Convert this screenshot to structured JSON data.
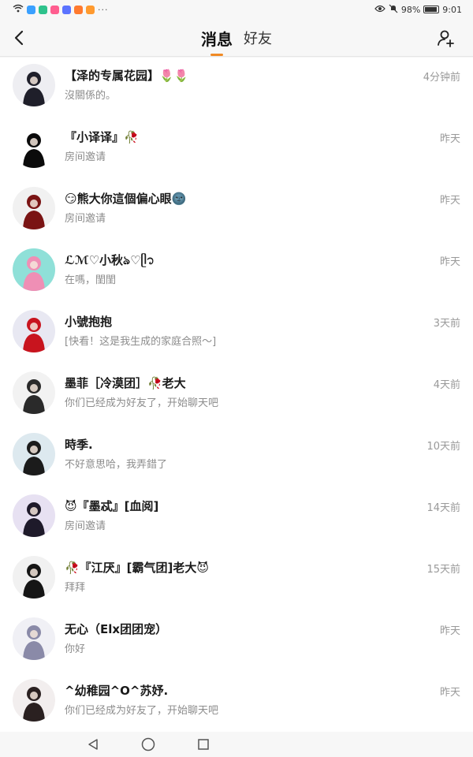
{
  "status_bar": {
    "battery": "98%",
    "time": "9:01",
    "more": "···",
    "app_colors": [
      "#3aa0ff",
      "#2ec28c",
      "#ff5d8f",
      "#5b73ff",
      "#ff7a2f",
      "#ff9a2f"
    ]
  },
  "header": {
    "tabs": [
      {
        "label": "消息",
        "active": true
      },
      {
        "label": "好友",
        "active": false
      }
    ],
    "accent_color": "#f08a24"
  },
  "messages": [
    {
      "name": "【泽的专属花园】🌷🌷",
      "preview": "沒關係的。",
      "time": "4分钟前",
      "avatar_bg": "#eeeef2",
      "avatar_fg": "#1f1f2a"
    },
    {
      "name": "『小译译』🥀",
      "preview": "房间邀请",
      "time": "昨天",
      "avatar_bg": "#ffffff",
      "avatar_fg": "#0b0b0b"
    },
    {
      "name": "😏熊大你這個偏心眼🌚",
      "preview": "房间邀请",
      "time": "昨天",
      "avatar_bg": "#f1f1f1",
      "avatar_fg": "#7a1414"
    },
    {
      "name": "ℒℳ♡小秋ঌ♡ᥫ᭡",
      "preview": "在嗎，閨閨",
      "time": "昨天",
      "avatar_bg": "#8fe0d8",
      "avatar_fg": "#ef8fb5"
    },
    {
      "name": "小號抱抱",
      "preview": "[快看！这是我生成的家庭合照～]",
      "time": "3天前",
      "avatar_bg": "#e8e8f2",
      "avatar_fg": "#c8141e"
    },
    {
      "name": "墨菲［冷漠团］🥀老大",
      "preview": "你们已经成为好友了，开始聊天吧",
      "time": "4天前",
      "avatar_bg": "#f2f2f2",
      "avatar_fg": "#2a2a2a"
    },
    {
      "name": "時季.",
      "preview": "不好意思哈，我弄錯了",
      "time": "10天前",
      "avatar_bg": "#dde9ef",
      "avatar_fg": "#1b1b1b"
    },
    {
      "name": "😈『墨忒』[血阅]",
      "preview": "房间邀请",
      "time": "14天前",
      "avatar_bg": "#e7e1f2",
      "avatar_fg": "#1e1a2a"
    },
    {
      "name": "🥀『江厌』[霸气团]老大😈",
      "preview": "拜拜",
      "time": "15天前",
      "avatar_bg": "#f1f1f1",
      "avatar_fg": "#151515"
    },
    {
      "name": "无心（Elx团团宠）",
      "preview": "你好",
      "time": "昨天",
      "avatar_bg": "#f0f0f5",
      "avatar_fg": "#8a8aa8"
    },
    {
      "name": "^幼稚园^O^苏妤.",
      "preview": "你们已经成为好友了，开始聊天吧",
      "time": "昨天",
      "avatar_bg": "#f2eeee",
      "avatar_fg": "#2a2020"
    }
  ]
}
